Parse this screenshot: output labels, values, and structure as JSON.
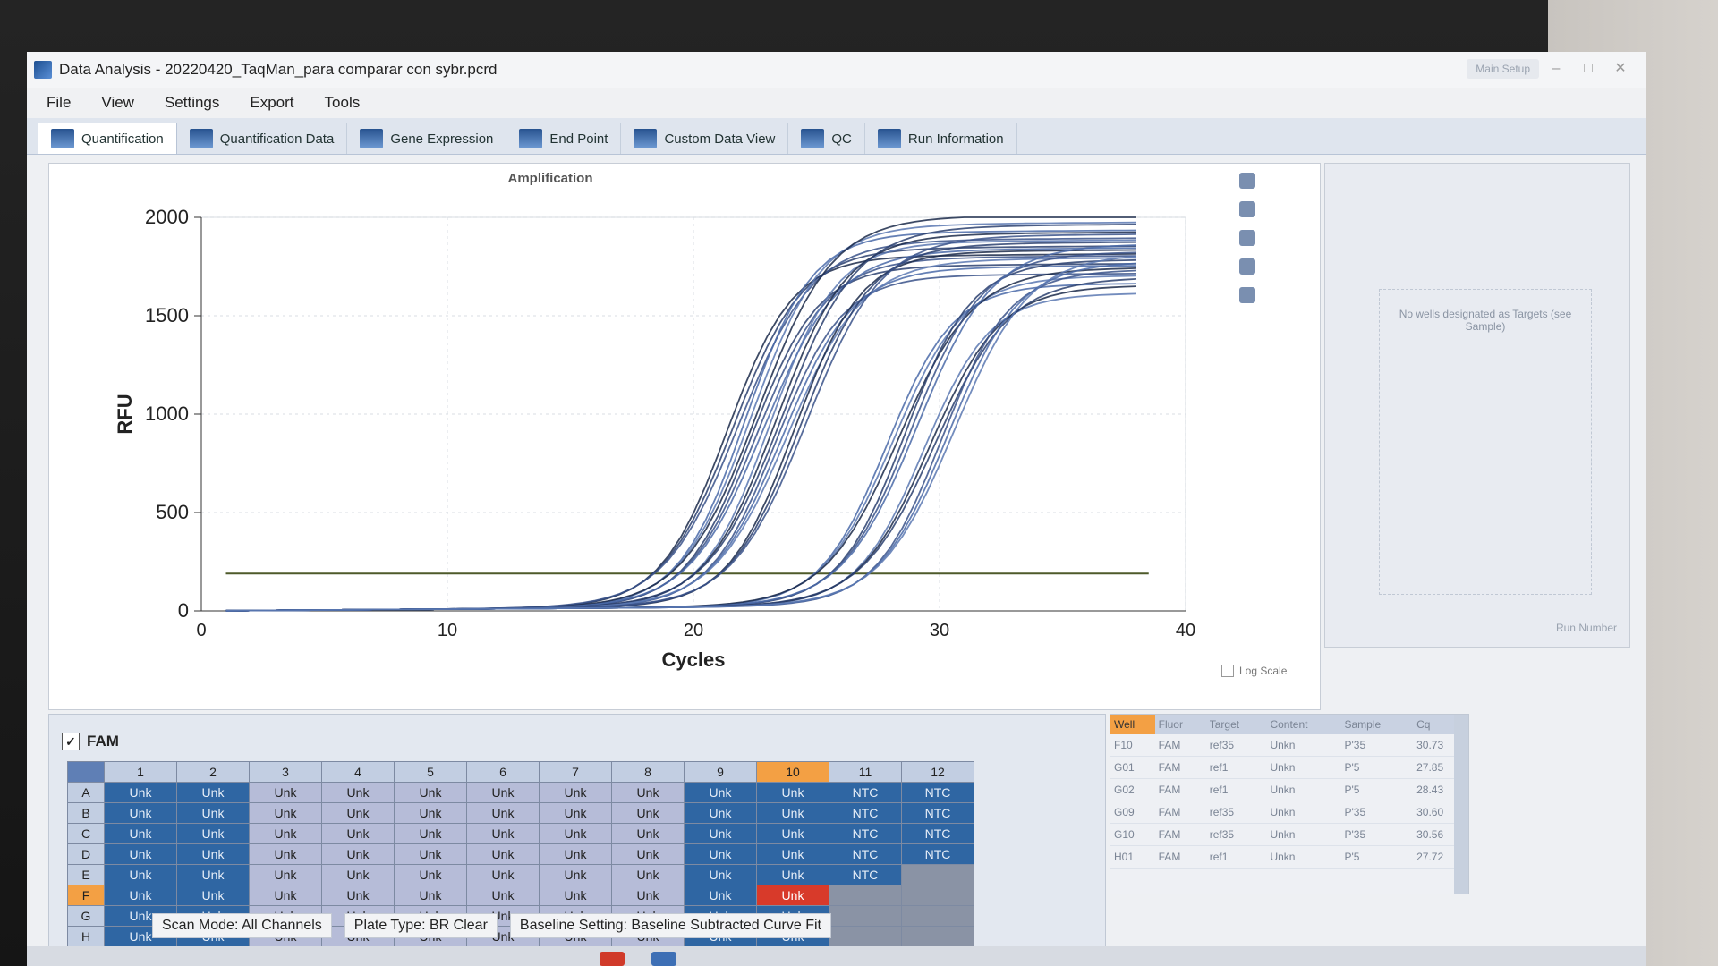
{
  "window": {
    "title": "Data Analysis - 20220420_TaqMan_para comparar con sybr.pcrd"
  },
  "menu": [
    "File",
    "View",
    "Settings",
    "Export",
    "Tools"
  ],
  "tabs": [
    {
      "label": "Quantification",
      "active": true
    },
    {
      "label": "Quantification Data",
      "active": false
    },
    {
      "label": "Gene Expression",
      "active": false
    },
    {
      "label": "End Point",
      "active": false
    },
    {
      "label": "Custom Data View",
      "active": false
    },
    {
      "label": "QC",
      "active": false
    },
    {
      "label": "Run Information",
      "active": false
    }
  ],
  "chart_data": {
    "type": "line",
    "title": "Amplification",
    "xlabel": "Cycles",
    "ylabel": "RFU",
    "xlim": [
      0,
      40
    ],
    "ylim": [
      0,
      2000
    ],
    "x_ticks": [
      0,
      10,
      20,
      30,
      40
    ],
    "y_ticks": [
      0,
      500,
      1000,
      1500,
      2000
    ],
    "grid": true,
    "threshold_rfu": 190,
    "series_colors": [
      "#1b2a4a",
      "#2a3f6e",
      "#3a528a",
      "#4a6aa8",
      "#5a78b2"
    ],
    "curve_groups": [
      {
        "ct": 19.5,
        "plateau": 1900,
        "count": 6
      },
      {
        "ct": 20.5,
        "plateau": 1850,
        "count": 6
      },
      {
        "ct": 21.5,
        "plateau": 1800,
        "count": 6
      },
      {
        "ct": 26.0,
        "plateau": 1750,
        "count": 6
      },
      {
        "ct": 27.5,
        "plateau": 1700,
        "count": 6
      }
    ]
  },
  "log_scale_label": "Log Scale",
  "fluorophore": "FAM",
  "plate": {
    "columns": [
      "1",
      "2",
      "3",
      "4",
      "5",
      "6",
      "7",
      "8",
      "9",
      "10",
      "11",
      "12"
    ],
    "rows": [
      "A",
      "B",
      "C",
      "D",
      "E",
      "F",
      "G",
      "H"
    ],
    "highlight_column": "10",
    "highlight_row": "F",
    "cells": [
      [
        "Unk",
        "Unk",
        "Unk",
        "Unk",
        "Unk",
        "Unk",
        "Unk",
        "Unk",
        "Unk",
        "Unk",
        "NTC",
        "NTC"
      ],
      [
        "Unk",
        "Unk",
        "Unk",
        "Unk",
        "Unk",
        "Unk",
        "Unk",
        "Unk",
        "Unk",
        "Unk",
        "NTC",
        "NTC"
      ],
      [
        "Unk",
        "Unk",
        "Unk",
        "Unk",
        "Unk",
        "Unk",
        "Unk",
        "Unk",
        "Unk",
        "Unk",
        "NTC",
        "NTC"
      ],
      [
        "Unk",
        "Unk",
        "Unk",
        "Unk",
        "Unk",
        "Unk",
        "Unk",
        "Unk",
        "Unk",
        "Unk",
        "NTC",
        "NTC"
      ],
      [
        "Unk",
        "Unk",
        "Unk",
        "Unk",
        "Unk",
        "Unk",
        "Unk",
        "Unk",
        "Unk",
        "Unk",
        "NTC",
        ""
      ],
      [
        "Unk",
        "Unk",
        "Unk",
        "Unk",
        "Unk",
        "Unk",
        "Unk",
        "Unk",
        "Unk",
        "Unk",
        "",
        ""
      ],
      [
        "Unk",
        "Unk",
        "Unk",
        "Unk",
        "Unk",
        "Unk",
        "Unk",
        "Unk",
        "Unk",
        "Unk",
        "",
        ""
      ],
      [
        "Unk",
        "Unk",
        "Unk",
        "Unk",
        "Unk",
        "Unk",
        "Unk",
        "Unk",
        "Unk",
        "Unk",
        "",
        ""
      ]
    ]
  },
  "results_table": {
    "headers": [
      "Well",
      "Fluor",
      "Target",
      "Content",
      "Sample",
      "Cq"
    ],
    "rows": [
      [
        "F10",
        "FAM",
        "ref35",
        "Unkn",
        "P'35",
        "30.73"
      ],
      [
        "G01",
        "FAM",
        "ref1",
        "Unkn",
        "P'5",
        "27.85"
      ],
      [
        "G02",
        "FAM",
        "ref1",
        "Unkn",
        "P'5",
        "28.43"
      ],
      [
        "G09",
        "FAM",
        "ref35",
        "Unkn",
        "P'35",
        "30.60"
      ],
      [
        "G10",
        "FAM",
        "ref35",
        "Unkn",
        "P'35",
        "30.56"
      ],
      [
        "H01",
        "FAM",
        "ref1",
        "Unkn",
        "P'5",
        "27.72"
      ]
    ]
  },
  "status": {
    "scan_mode": "Scan Mode: All Channels",
    "plate_type": "Plate Type: BR Clear",
    "baseline": "Baseline Setting: Baseline Subtracted Curve Fit"
  },
  "side_panel": {
    "message": "No wells designated as Targets (see Sample)",
    "label": "Run Number"
  },
  "user": {
    "label": "Main Setup"
  }
}
